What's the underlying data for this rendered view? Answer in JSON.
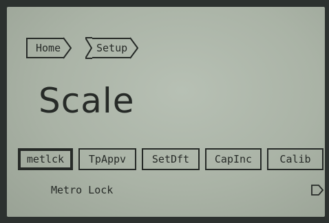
{
  "breadcrumb": {
    "items": [
      {
        "label": "Home"
      },
      {
        "label": "Setup"
      }
    ]
  },
  "page": {
    "title": "Scale"
  },
  "softkeys": [
    {
      "label": "metlck",
      "selected": true
    },
    {
      "label": "TpAppv"
    },
    {
      "label": "SetDft"
    },
    {
      "label": "CapInc"
    },
    {
      "label": "Calib"
    }
  ],
  "selected_description": "Metro Lock",
  "icons": {
    "more": "next-arrow-icon"
  },
  "colors": {
    "lcd_background": "#b0b9ac",
    "ink": "#262a27"
  }
}
